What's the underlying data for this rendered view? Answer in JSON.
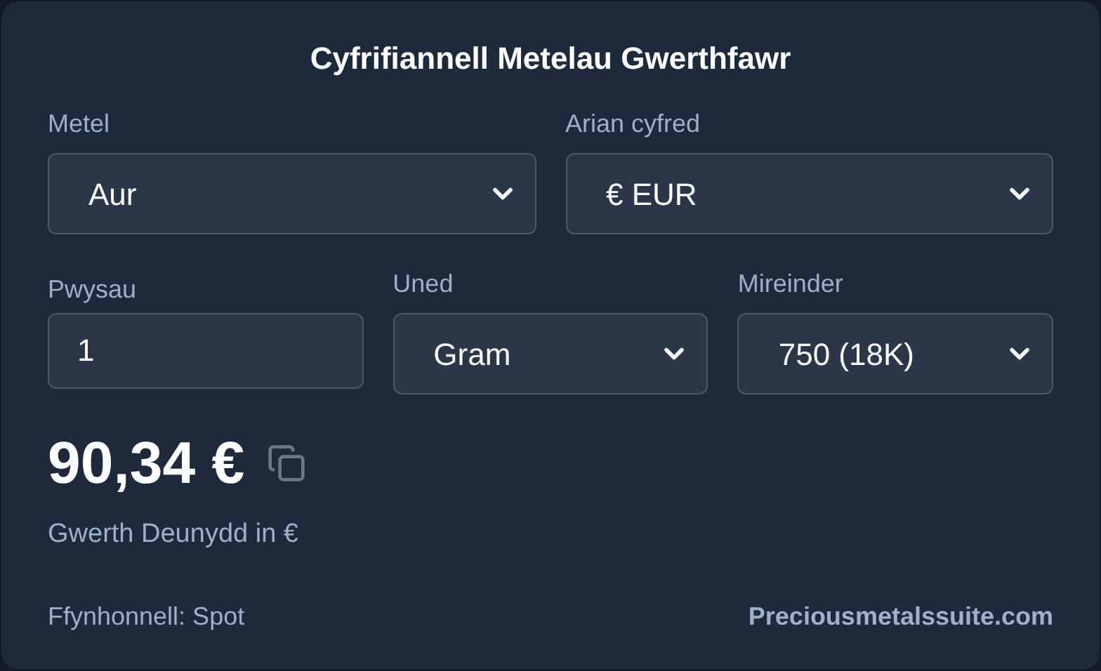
{
  "title": "Cyfrifiannell Metelau Gwerthfawr",
  "row_1": [
    {
      "label": "Metel",
      "kind": "select",
      "value": "Aur"
    },
    {
      "label": "Arian cyfred",
      "kind": "select",
      "value": "€ EUR"
    }
  ],
  "row_2": [
    {
      "label": "Pwysau",
      "kind": "input",
      "value": "1"
    },
    {
      "label": "Uned",
      "kind": "select",
      "value": "Gram"
    },
    {
      "label": "Mireinder",
      "kind": "select",
      "value": "750 (18K)"
    }
  ],
  "result": {
    "value": "90,34 €",
    "caption": "Gwerth Deunydd in €"
  },
  "footer": {
    "source": "Ffynhonnell: Spot",
    "link": "Preciousmetalssuite.com"
  }
}
